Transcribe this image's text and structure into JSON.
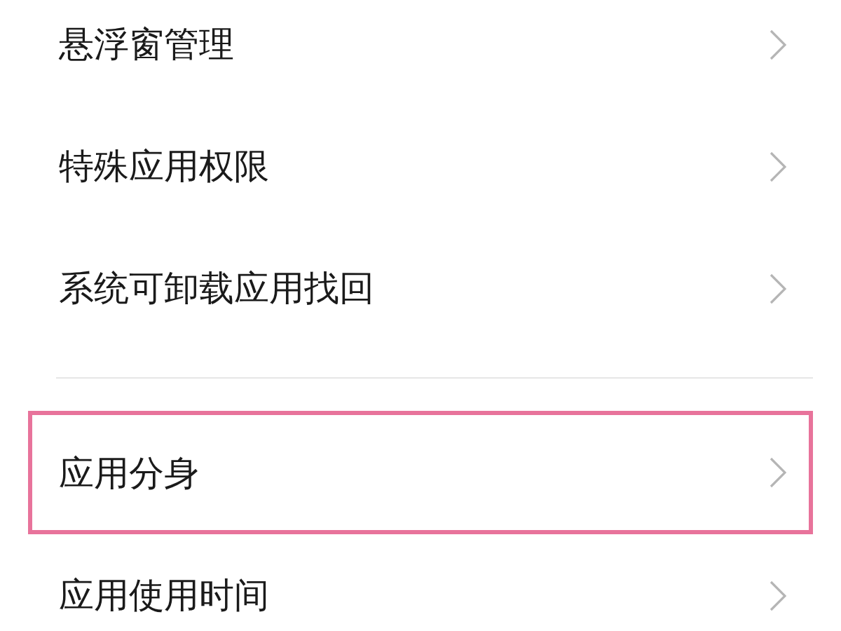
{
  "groups": [
    {
      "items": [
        {
          "label": "悬浮窗管理",
          "highlighted": false
        },
        {
          "label": "特殊应用权限",
          "highlighted": false
        },
        {
          "label": "系统可卸载应用找回",
          "highlighted": false
        }
      ]
    },
    {
      "items": [
        {
          "label": "应用分身",
          "highlighted": true
        },
        {
          "label": "应用使用时间",
          "highlighted": false
        }
      ]
    }
  ]
}
